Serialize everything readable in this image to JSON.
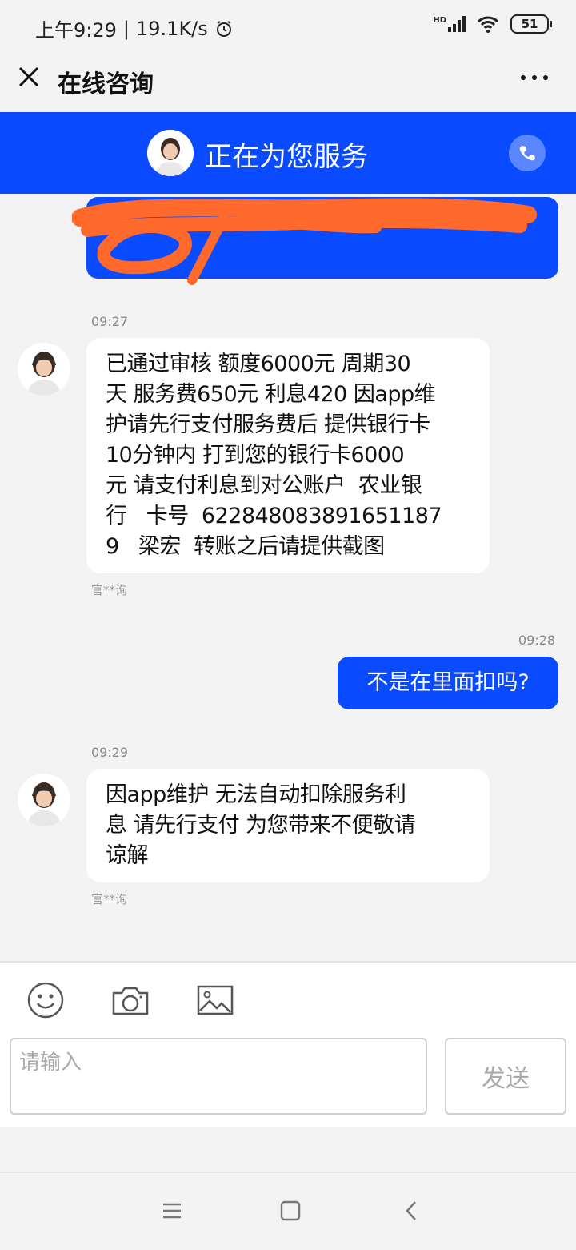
{
  "status_bar": {
    "time": "上午9:29",
    "separator": "|",
    "speed": "19.1K/s",
    "network": "HD",
    "battery": "51"
  },
  "header": {
    "title": "在线咨询"
  },
  "service": {
    "title": "正在为您服务"
  },
  "messages": [
    {
      "time": "09:27",
      "text": "已通过审核 额度6000元 周期30\n天 服务费650元 利息420 因app维\n护请先行支付服务费后 提供银行卡\n10分钟内 打到您的银行卡6000\n元 请支付利息到对公账户  农业银\n行   卡号  622848083891651187\n9   梁宏  转账之后请提供截图",
      "sender": "官**询"
    },
    {
      "time": "09:28",
      "text": "不是在里面扣吗?"
    },
    {
      "time": "09:29",
      "text": "因app维护 无法自动扣除服务利\n息 请先行支付 为您带来不便敬请\n谅解",
      "sender": "官**询"
    }
  ],
  "composer": {
    "placeholder": "请输入",
    "send_label": "发送"
  },
  "colors": {
    "accent": "#0a4bff",
    "redaction": "#ff6a2c"
  }
}
